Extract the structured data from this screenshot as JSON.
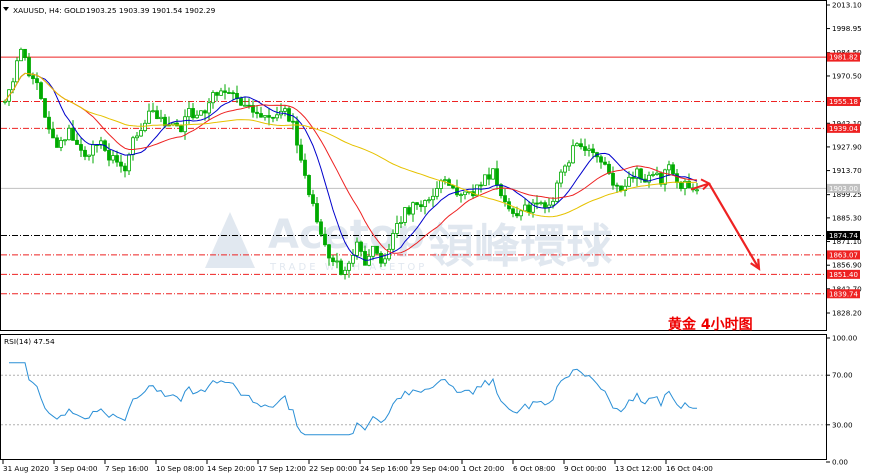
{
  "header": {
    "symbol_text": "XAUUSD, H4:  GOLD",
    "ohlc_text": "1903.25 1903.39 1901.54 1902.29"
  },
  "annotation": {
    "text": "黄金   4小时图"
  },
  "watermark": {
    "latin": "Acetop",
    "latin_sub": "TRADE WITH ACETOP",
    "chinese": "領峰環球"
  },
  "colors": {
    "bull": "#00aa00",
    "bear": "#00aa00",
    "ma_fast": "#0000cc",
    "ma_mid": "#ee2222",
    "ma_slow": "#e6c200",
    "rsi": "#2a8fd6",
    "level": "#ee2222",
    "arrow": "#ee2222",
    "annotation": "#ee0000"
  },
  "chart_data": [
    {
      "type": "line",
      "subtype": "candlestick",
      "title": "",
      "y_axis_position": "right",
      "ylim": [
        1828.2,
        2013.1
      ],
      "y_ticks": [
        2013.1,
        1998.95,
        1984.5,
        1970.5,
        1956.05,
        1942.1,
        1927.9,
        1913.7,
        1899.25,
        1885.3,
        1871.1,
        1856.9,
        1842.7,
        1828.2
      ],
      "x_tick_labels": [
        "31 Aug 2020",
        "3 Sep 04:00",
        "7 Sep 16:00",
        "10 Sep 08:00",
        "14 Sep 20:00",
        "17 Sep 12:00",
        "22 Sep 00:00",
        "24 Sep 16:00",
        "29 Sep 04:00",
        "1 Oct 20:00",
        "6 Oct 08:00",
        "9 Oct 00:00",
        "13 Oct 12:00",
        "16 Oct 04:00"
      ],
      "price_anchors": [
        [
          0,
          1955
        ],
        [
          2,
          1968
        ],
        [
          4,
          1988
        ],
        [
          6,
          1970
        ],
        [
          8,
          1965
        ],
        [
          10,
          1945
        ],
        [
          13,
          1928
        ],
        [
          16,
          1938
        ],
        [
          20,
          1925
        ],
        [
          24,
          1930
        ],
        [
          26,
          1918
        ],
        [
          28,
          1922
        ],
        [
          30,
          1916
        ],
        [
          32,
          1930
        ],
        [
          36,
          1948
        ],
        [
          40,
          1942
        ],
        [
          44,
          1938
        ],
        [
          46,
          1950
        ],
        [
          48,
          1945
        ],
        [
          52,
          1958
        ],
        [
          56,
          1962
        ],
        [
          58,
          1958
        ],
        [
          60,
          1952
        ],
        [
          62,
          1948
        ],
        [
          64,
          1943
        ],
        [
          66,
          1946
        ],
        [
          70,
          1948
        ],
        [
          72,
          1944
        ],
        [
          74,
          1920
        ],
        [
          76,
          1900
        ],
        [
          78,
          1885
        ],
        [
          80,
          1868
        ],
        [
          82,
          1860
        ],
        [
          84,
          1852
        ],
        [
          86,
          1856
        ],
        [
          88,
          1868
        ],
        [
          90,
          1860
        ],
        [
          92,
          1870
        ],
        [
          94,
          1860
        ],
        [
          96,
          1868
        ],
        [
          98,
          1882
        ],
        [
          100,
          1888
        ],
        [
          104,
          1895
        ],
        [
          108,
          1902
        ],
        [
          110,
          1908
        ],
        [
          112,
          1903
        ],
        [
          116,
          1898
        ],
        [
          120,
          1910
        ],
        [
          122,
          1914
        ],
        [
          124,
          1898
        ],
        [
          128,
          1887
        ],
        [
          130,
          1890
        ],
        [
          134,
          1893
        ],
        [
          136,
          1890
        ],
        [
          138,
          1905
        ],
        [
          140,
          1915
        ],
        [
          142,
          1926
        ],
        [
          144,
          1930
        ],
        [
          146,
          1926
        ],
        [
          148,
          1922
        ],
        [
          150,
          1916
        ],
        [
          152,
          1906
        ],
        [
          154,
          1901
        ],
        [
          156,
          1908
        ],
        [
          158,
          1912
        ],
        [
          160,
          1905
        ],
        [
          162,
          1912
        ],
        [
          164,
          1909
        ],
        [
          166,
          1915
        ],
        [
          168,
          1904
        ],
        [
          170,
          1906
        ],
        [
          172,
          1903
        ]
      ],
      "levels": [
        {
          "value": 1981.82,
          "label": "1981.82",
          "style": "solid",
          "color": "#ee2222"
        },
        {
          "value": 1955.18,
          "label": "1955.18",
          "style": "dashdot",
          "color": "#ee2222"
        },
        {
          "value": 1939.04,
          "label": "1939.04",
          "style": "dashdot",
          "color": "#ee2222"
        },
        {
          "value": 1903.0,
          "label": "1903.00",
          "style": "solid",
          "color": "#c0c0c0"
        },
        {
          "value": 1874.74,
          "label": "1874.74",
          "style": "dashdot",
          "color": "#000000"
        },
        {
          "value": 1863.07,
          "label": "1863.07",
          "style": "dashdot",
          "color": "#ee2222"
        },
        {
          "value": 1851.4,
          "label": "1851.40",
          "style": "dashdot",
          "color": "#ee2222"
        },
        {
          "value": 1839.74,
          "label": "1839.74",
          "style": "dashdot",
          "color": "#ee2222"
        }
      ],
      "series": [
        {
          "name": "",
          "kind": "candles"
        },
        {
          "name": "",
          "kind": "ma",
          "period": 10
        },
        {
          "name": "",
          "kind": "ma",
          "period": 20
        },
        {
          "name": "",
          "kind": "ma",
          "period": 60
        }
      ],
      "forecast_arrow": {
        "points": [
          [
            173,
            1906
          ],
          [
            178,
            1870
          ],
          [
            185,
            1862
          ]
        ]
      },
      "grid": false,
      "legend": "none"
    },
    {
      "type": "line",
      "title": "RSI(14) 47.54",
      "ylim": [
        0,
        100
      ],
      "y_ticks": [
        100.0,
        70.0,
        30.0,
        0.0
      ],
      "levels": [
        70,
        30
      ],
      "series": [
        {
          "name": "RSI(14)",
          "period": 14
        }
      ],
      "grid": false,
      "legend": "none"
    }
  ]
}
